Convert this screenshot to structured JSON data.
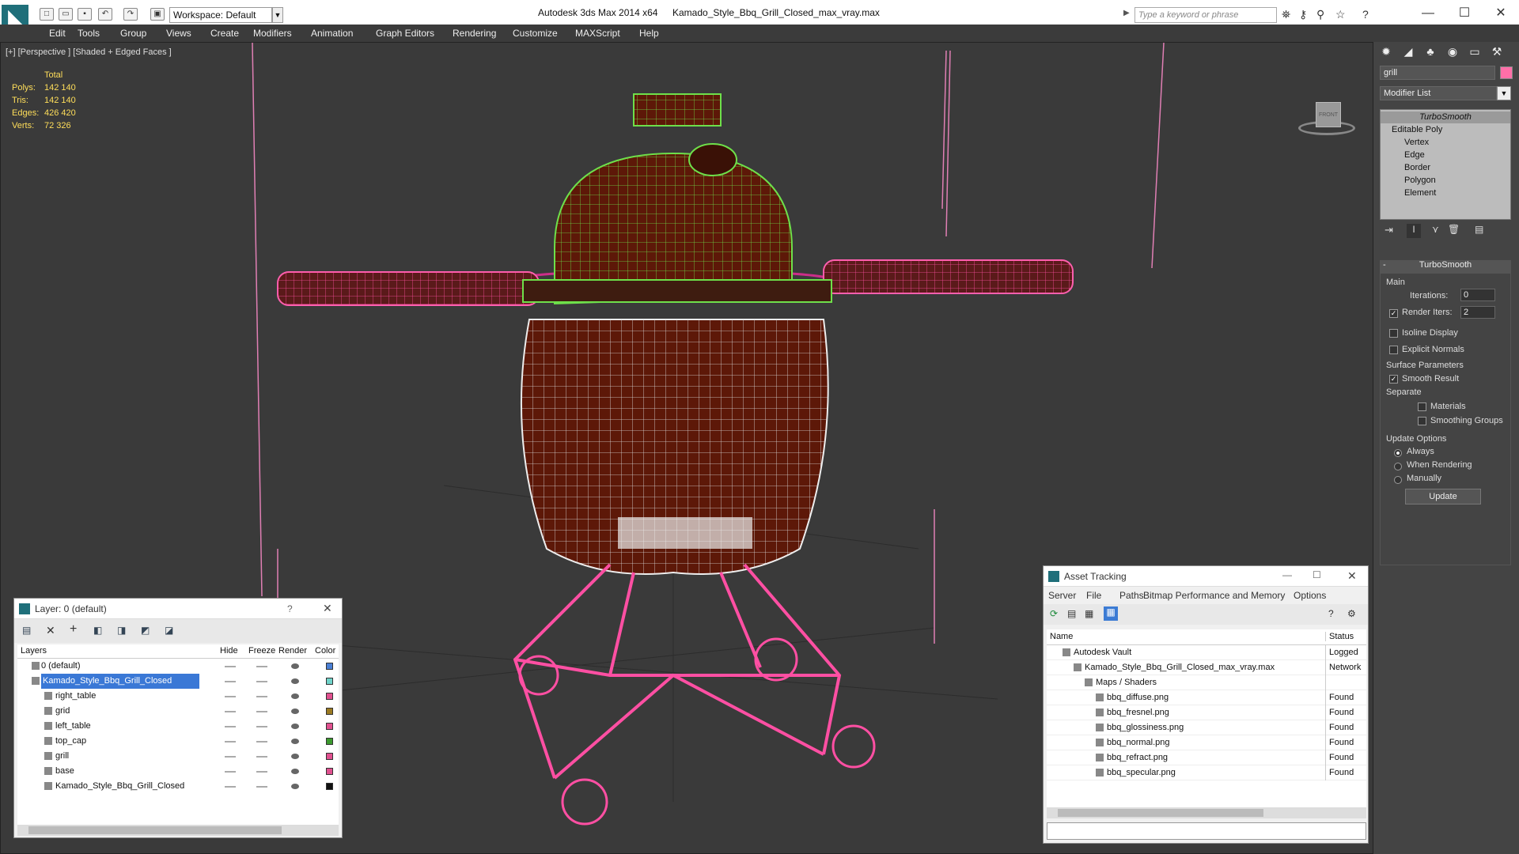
{
  "titlebar": {
    "workspace_label": "Workspace: Default",
    "app_title": "Autodesk 3ds Max  2014 x64",
    "file_title": "Kamado_Style_Bbq_Grill_Closed_max_vray.max",
    "search_placeholder": "Type a keyword or phrase"
  },
  "menu": [
    "Edit",
    "Tools",
    "Group",
    "Views",
    "Create",
    "Modifiers",
    "Animation",
    "Graph Editors",
    "Rendering",
    "Customize",
    "MAXScript",
    "Help"
  ],
  "viewport": {
    "label": "[+] [Perspective ] [Shaded + Edged Faces ]",
    "stats": {
      "header": "Total",
      "rows": [
        {
          "label": "Polys:",
          "value": "142 140"
        },
        {
          "label": "Tris:",
          "value": "142 140"
        },
        {
          "label": "Edges:",
          "value": "426 420"
        },
        {
          "label": "Verts:",
          "value": "72 326"
        }
      ]
    },
    "viewcube_label": "FRONT"
  },
  "command_panel": {
    "object_name": "grill",
    "object_color": "#ff6fa8",
    "modifier_list": "Modifier List",
    "stack": [
      "TurboSmooth",
      "Editable Poly",
      "Vertex",
      "Edge",
      "Border",
      "Polygon",
      "Element"
    ],
    "rollout_title": "TurboSmooth",
    "main_label": "Main",
    "iterations_label": "Iterations:",
    "iterations_value": "0",
    "render_iters_label": "Render Iters:",
    "render_iters_value": "2",
    "isoline_label": "Isoline Display",
    "explicit_normals_label": "Explicit Normals",
    "surface_params_label": "Surface Parameters",
    "smooth_result_label": "Smooth Result",
    "separate_label": "Separate",
    "materials_label": "Materials",
    "smoothing_groups_label": "Smoothing Groups",
    "update_options_label": "Update Options",
    "always_label": "Always",
    "when_rendering_label": "When Rendering",
    "manually_label": "Manually",
    "update_button": "Update"
  },
  "layer_window": {
    "title": "Layer: 0 (default)",
    "help": "?",
    "columns": [
      "Layers",
      "Hide",
      "Freeze",
      "Render",
      "Color"
    ],
    "rows": [
      {
        "name": "0 (default)",
        "color": "#4a7fd4",
        "indent": 0
      },
      {
        "name": "Kamado_Style_Bbq_Grill_Closed",
        "color": "#6fd3c9",
        "indent": 0,
        "selected": true
      },
      {
        "name": "right_table",
        "color": "#e0508f",
        "indent": 1
      },
      {
        "name": "grid",
        "color": "#9b7a22",
        "indent": 1
      },
      {
        "name": "left_table",
        "color": "#e0508f",
        "indent": 1
      },
      {
        "name": "top_cap",
        "color": "#3c9a2e",
        "indent": 1
      },
      {
        "name": "grill",
        "color": "#e0508f",
        "indent": 1
      },
      {
        "name": "base",
        "color": "#e0508f",
        "indent": 1
      },
      {
        "name": "Kamado_Style_Bbq_Grill_Closed",
        "color": "#111111",
        "indent": 1
      }
    ]
  },
  "asset_window": {
    "title": "Asset Tracking",
    "menu": [
      "Server",
      "File",
      "Paths",
      "Bitmap Performance and Memory",
      "Options"
    ],
    "columns": [
      "Name",
      "Status"
    ],
    "rows": [
      {
        "name": "Autodesk Vault",
        "status": "Logged",
        "indent": 1
      },
      {
        "name": "Kamado_Style_Bbq_Grill_Closed_max_vray.max",
        "status": "Network",
        "indent": 2
      },
      {
        "name": "Maps / Shaders",
        "status": "",
        "indent": 3
      },
      {
        "name": "bbq_diffuse.png",
        "status": "Found",
        "indent": 4
      },
      {
        "name": "bbq_fresnel.png",
        "status": "Found",
        "indent": 4
      },
      {
        "name": "bbq_glossiness.png",
        "status": "Found",
        "indent": 4
      },
      {
        "name": "bbq_normal.png",
        "status": "Found",
        "indent": 4
      },
      {
        "name": "bbq_refract.png",
        "status": "Found",
        "indent": 4
      },
      {
        "name": "bbq_specular.png",
        "status": "Found",
        "indent": 4
      }
    ]
  }
}
